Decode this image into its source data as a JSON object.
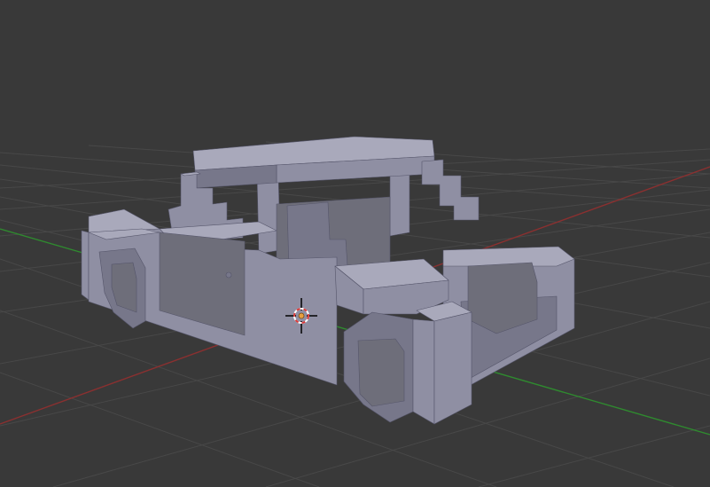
{
  "app": "3D viewport",
  "viewport": {
    "background_color": "#393939",
    "grid_color": "#484848",
    "x_axis_color": "#8a3030",
    "y_axis_color": "#2f8a2f",
    "view": "user-perspective",
    "shading": "solid"
  },
  "scene": {
    "object": {
      "name": "voxel-car",
      "base_color": "#8f8fa3",
      "light_color": "#a9a9bb",
      "dark_color": "#77778a",
      "window_color": "#6e6e7a"
    },
    "cursor": {
      "icon": "3d-cursor-icon",
      "ring_color_a": "#d83a3a",
      "ring_color_b": "#ffffff",
      "cross_color": "#000000"
    }
  }
}
